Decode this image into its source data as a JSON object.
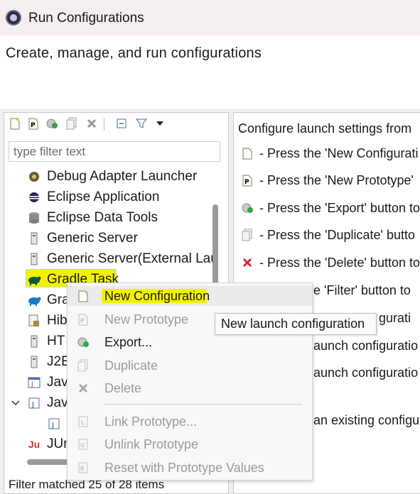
{
  "window": {
    "title": "Run Configurations",
    "icon": "eclipse-icon"
  },
  "header": {
    "subtitle": "Create, manage, and run configurations"
  },
  "toolbar": {
    "buttons": [
      {
        "name": "new-config-icon"
      },
      {
        "name": "new-prototype-icon"
      },
      {
        "name": "export-icon"
      },
      {
        "name": "duplicate-icon"
      },
      {
        "name": "delete-icon"
      },
      {
        "name": "collapse-all-icon"
      },
      {
        "name": "filter-icon"
      },
      {
        "name": "chevron-down-icon"
      }
    ]
  },
  "filter": {
    "placeholder": "type filter text",
    "value": ""
  },
  "tree": {
    "items": [
      {
        "label": "Debug Adapter Launcher",
        "icon": "debug-adapter-icon"
      },
      {
        "label": "Eclipse Application",
        "icon": "eclipse-app-icon"
      },
      {
        "label": "Eclipse Data Tools",
        "icon": "database-icon"
      },
      {
        "label": "Generic Server",
        "icon": "server-icon"
      },
      {
        "label": "Generic Server(External Lau",
        "icon": "server-icon"
      },
      {
        "label": "Gradle Task",
        "icon": "gradle-icon"
      },
      {
        "label": "Gra",
        "icon": "gradle-icon"
      },
      {
        "label": "Hib",
        "icon": "hibernate-icon"
      },
      {
        "label": "HT",
        "icon": "server-icon"
      },
      {
        "label": "J2E",
        "icon": "server-icon"
      },
      {
        "label": "Jav",
        "icon": "java-app-icon"
      },
      {
        "label": "Jav",
        "icon": "java-icon",
        "expander": "v"
      },
      {
        "label": "",
        "icon": "java-icon"
      },
      {
        "label": "JUn",
        "icon": "junit-icon",
        "badge": "Ju"
      }
    ]
  },
  "status": {
    "text": "Filter matched 25 of 28 items"
  },
  "right_panel": {
    "heading": "Configure launch settings from",
    "lines": [
      {
        "icon": "new-config-icon",
        "text": "- Press the 'New Configurati"
      },
      {
        "icon": "new-prototype-icon",
        "text": "- Press the 'New Prototype'"
      },
      {
        "icon": "export-icon",
        "text": "- Press the 'Export' button to"
      },
      {
        "icon": "duplicate-icon",
        "text": "- Press the 'Duplicate' butto"
      },
      {
        "icon": "delete-icon",
        "text": "- Press the 'Delete' button to"
      },
      {
        "icon": "",
        "text": "e 'Filter' button to"
      },
      {
        "icon": "",
        "text": "gurati"
      },
      {
        "icon": "",
        "text": "aunch configuratio"
      },
      {
        "icon": "",
        "text": "aunch configuratio"
      },
      {
        "icon": "",
        "text": "an existing configu"
      }
    ]
  },
  "context_menu": {
    "items": [
      {
        "label": "New Configuration",
        "icon": "new-config-icon",
        "enabled": true
      },
      {
        "label": "New Prototype",
        "icon": "new-prototype-icon",
        "enabled": false
      },
      {
        "label": "Export...",
        "icon": "export-icon",
        "enabled": true
      },
      {
        "label": "Duplicate",
        "icon": "duplicate-icon",
        "enabled": false
      },
      {
        "label": "Delete",
        "icon": "delete-icon",
        "enabled": false
      },
      {
        "label": "Link Prototype...",
        "icon": "link-prototype-icon",
        "enabled": false
      },
      {
        "label": "Unlink Prototype",
        "icon": "unlink-prototype-icon",
        "enabled": false
      },
      {
        "label": "Reset with Prototype Values",
        "icon": "reset-prototype-icon",
        "enabled": false
      }
    ]
  },
  "tooltip": {
    "text": "New launch configuration"
  },
  "colors": {
    "highlight": "#f2f200",
    "delete_red": "#d9262c",
    "title_bg": "#f5eeee"
  }
}
